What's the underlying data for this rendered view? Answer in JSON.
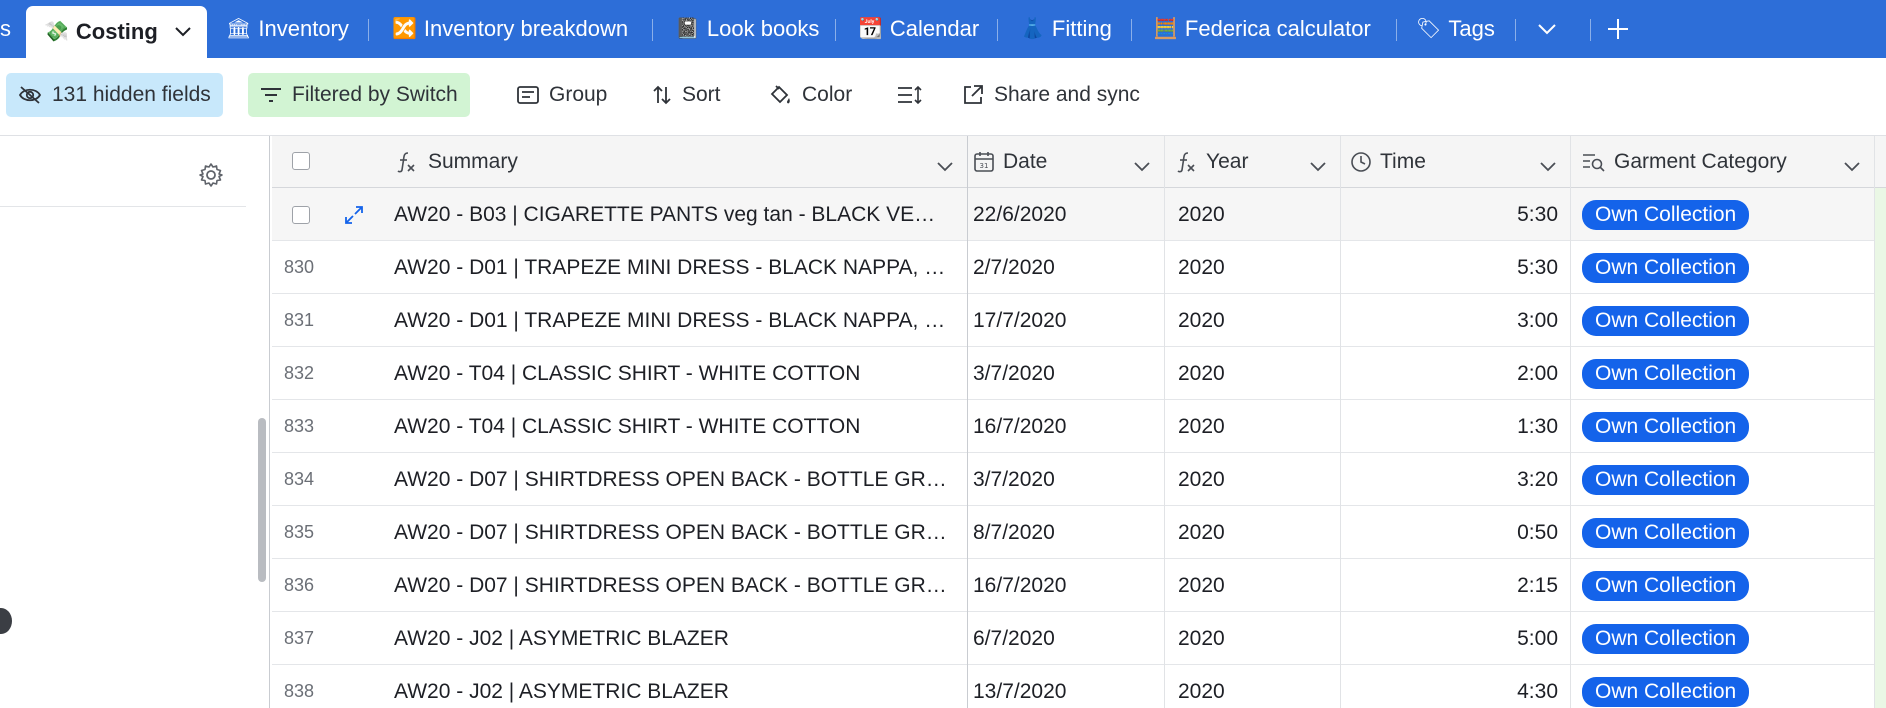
{
  "tabs": {
    "partial_left": "s",
    "active": {
      "emoji": "💸",
      "label": "Costing"
    },
    "items": [
      {
        "emoji": "🏛",
        "label": "Inventory"
      },
      {
        "emoji": "🔀",
        "label": "Inventory breakdown"
      },
      {
        "emoji": "📓",
        "label": "Look books"
      },
      {
        "emoji": "📆",
        "label": "Calendar"
      },
      {
        "emoji": "👗",
        "label": "Fitting"
      },
      {
        "emoji": "🧮",
        "label": "Federica calculator"
      },
      {
        "emoji": "🏷",
        "label": "Tags"
      }
    ]
  },
  "toolbar": {
    "hidden_fields": "131 hidden fields",
    "filtered": "Filtered by Switch",
    "group": "Group",
    "sort": "Sort",
    "color": "Color",
    "share": "Share and sync"
  },
  "columns": {
    "summary": "Summary",
    "date": "Date",
    "year": "Year",
    "time": "Time",
    "garment_category": "Garment Category"
  },
  "rows": [
    {
      "num": "",
      "summary": "AW20 - B03 | CIGARETTE PANTS veg tan - BLACK VE…",
      "date": "22/6/2020",
      "year": "2020",
      "time": "5:30",
      "category": "Own Collection"
    },
    {
      "num": "830",
      "summary": "AW20 - D01 | TRAPEZE MINI DRESS - BLACK NAPPA, …",
      "date": "2/7/2020",
      "year": "2020",
      "time": "5:30",
      "category": "Own Collection"
    },
    {
      "num": "831",
      "summary": "AW20 - D01 | TRAPEZE MINI DRESS - BLACK NAPPA, …",
      "date": "17/7/2020",
      "year": "2020",
      "time": "3:00",
      "category": "Own Collection"
    },
    {
      "num": "832",
      "summary": "AW20 - T04 | CLASSIC SHIRT - WHITE COTTON",
      "date": "3/7/2020",
      "year": "2020",
      "time": "2:00",
      "category": "Own Collection"
    },
    {
      "num": "833",
      "summary": "AW20 - T04 | CLASSIC SHIRT - WHITE COTTON",
      "date": "16/7/2020",
      "year": "2020",
      "time": "1:30",
      "category": "Own Collection"
    },
    {
      "num": "834",
      "summary": "AW20 - D07 | SHIRTDRESS OPEN BACK - BOTTLE GR…",
      "date": "3/7/2020",
      "year": "2020",
      "time": "3:20",
      "category": "Own Collection"
    },
    {
      "num": "835",
      "summary": "AW20 - D07 | SHIRTDRESS OPEN BACK - BOTTLE GR…",
      "date": "8/7/2020",
      "year": "2020",
      "time": "0:50",
      "category": "Own Collection"
    },
    {
      "num": "836",
      "summary": "AW20 - D07 | SHIRTDRESS OPEN BACK - BOTTLE GR…",
      "date": "16/7/2020",
      "year": "2020",
      "time": "2:15",
      "category": "Own Collection"
    },
    {
      "num": "837",
      "summary": "AW20 - J02 | ASYMETRIC BLAZER",
      "date": "6/7/2020",
      "year": "2020",
      "time": "5:00",
      "category": "Own Collection"
    },
    {
      "num": "838",
      "summary": "AW20 - J02 | ASYMETRIC BLAZER",
      "date": "13/7/2020",
      "year": "2020",
      "time": "4:30",
      "category": "Own Collection"
    }
  ],
  "colors": {
    "tabbar": "#2d6ed8",
    "pill": "#1463ea",
    "hidden_fields_bg": "#c8e8fb",
    "filtered_bg": "#d2f4d3"
  }
}
